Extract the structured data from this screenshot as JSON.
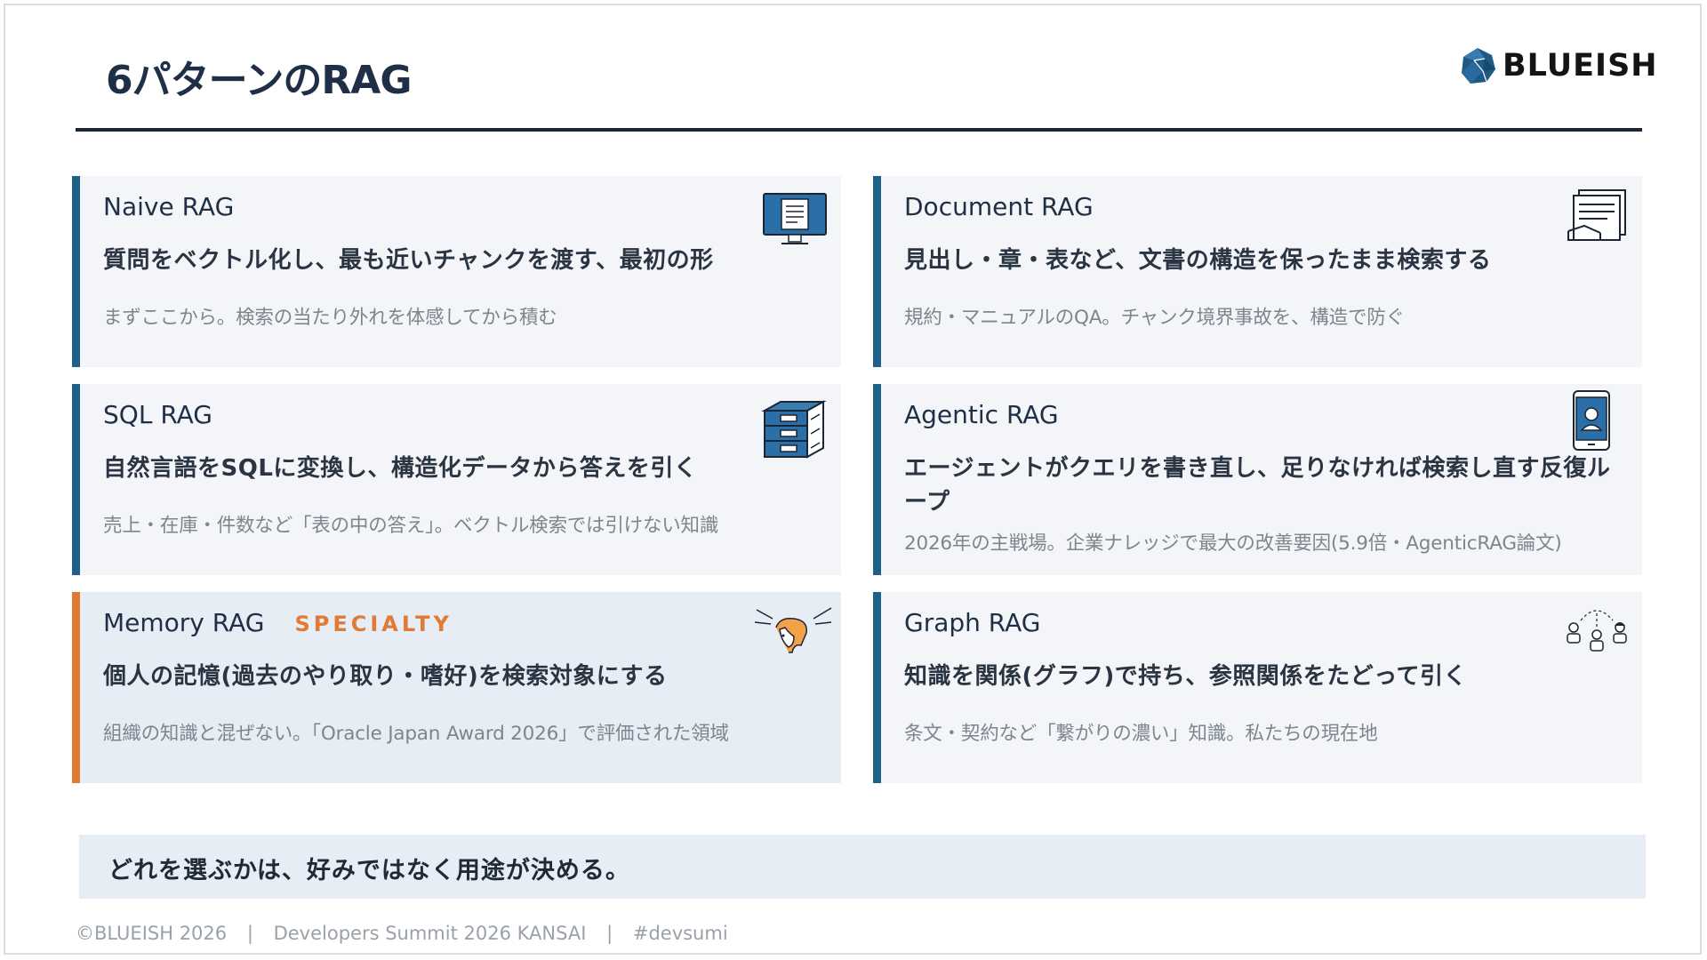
{
  "header": {
    "title": "6パターンのRAG",
    "logo_text": "BLUEISH"
  },
  "cards": [
    {
      "name": "Naive RAG",
      "lead": "質問をベクトル化し、最も近いチャンクを渡す、最初の形",
      "note": "まずここから。検索の当たり外れを体感してから積む",
      "icon": "monitor-document-icon"
    },
    {
      "name": "Document RAG",
      "lead": "見出し・章・表など、文書の構造を保ったまま検索する",
      "note": "規約・マニュアルのQA。チャンク境界事故を、構造で防ぐ",
      "icon": "document-stack-icon"
    },
    {
      "name": "SQL RAG",
      "lead": "自然言語をSQLに変換し、構造化データから答えを引く",
      "note": "売上・在庫・件数など「表の中の答え」。ベクトル検索では引けない知識",
      "icon": "database-server-icon"
    },
    {
      "name": "Agentic RAG",
      "lead": "エージェントがクエリを書き直し、足りなければ検索し直す反復ループ",
      "note": "2026年の主戦場。企業ナレッジで最大の改善要因(5.9倍・AgenticRAG論文)",
      "icon": "smartphone-agent-icon"
    },
    {
      "name": "Memory RAG",
      "tag": "SPECIALTY",
      "lead": "個人の記憶(過去のやり取り・嗜好)を検索対象にする",
      "note": "組織の知識と混ぜない。「Oracle Japan Award 2026」で評価された領域",
      "icon": "person-memory-icon"
    },
    {
      "name": "Graph RAG",
      "lead": "知識を関係(グラフ)で持ち、参照関係をたどって引く",
      "note": "条文・契約など「繋がりの濃い」知識。私たちの現在地",
      "icon": "people-network-icon"
    }
  ],
  "summary": "どれを選ぶかは、好みではなく用途が決める。",
  "footer": {
    "copyright": "©BLUEISH 2026",
    "event": "Developers Summit 2026 KANSAI",
    "hashtag": "#devsumi",
    "separator": "|"
  },
  "colors": {
    "accent_blue": "#1e6188",
    "accent_orange": "#e07a35",
    "card_bg": "#f3f5f8",
    "highlight_bg": "#e6edf4",
    "rule": "#1b2533"
  }
}
